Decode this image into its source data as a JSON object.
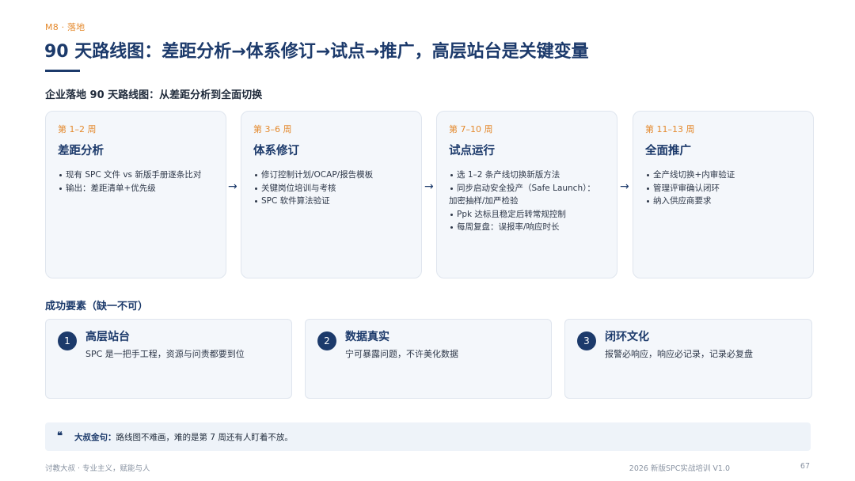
{
  "header": {
    "kicker": "M8 · 落地",
    "title": "90 天路线图：差距分析→体系修订→试点→推广，高层站台是关键变量",
    "subtitle": "企业落地 90 天路线图：从差距分析到全面切换"
  },
  "phases": [
    {
      "week": "第 1–2 周",
      "name": "差距分析",
      "items": [
        "现有 SPC 文件 vs 新版手册逐条比对",
        "输出：差距清单+优先级"
      ]
    },
    {
      "week": "第 3–6 周",
      "name": "体系修订",
      "items": [
        "修订控制计划/OCAP/报告模板",
        "关键岗位培训与考核",
        "SPC 软件算法验证"
      ]
    },
    {
      "week": "第 7–10 周",
      "name": "试点运行",
      "items": [
        "选 1–2 条产线切换新版方法",
        "同步启动安全投产（Safe Launch）：",
        "Ppk 达标且稳定后转常规控制",
        "每周复盘：误报率/响应时长"
      ],
      "item_continuation": "加密抽样/加严检验"
    },
    {
      "week": "第 11–13 周",
      "name": "全面推广",
      "items": [
        "全产线切换+内审验证",
        "管理评审确认闭环",
        "纳入供应商要求"
      ]
    }
  ],
  "arrow_glyph": "→",
  "success": {
    "title": "成功要素（缺一不可）",
    "factors": [
      {
        "num": "1",
        "name": "高层站台",
        "desc": "SPC 是一把手工程，资源与问责都要到位"
      },
      {
        "num": "2",
        "name": "数据真实",
        "desc": "宁可暴露问题，不许美化数据"
      },
      {
        "num": "3",
        "name": "闭环文化",
        "desc": "报警必响应，响应必记录，记录必复盘"
      }
    ]
  },
  "quote": {
    "icon": "quote-icon",
    "label": "大叔金句：",
    "text": "路线图不难画，难的是第 7 周还有人盯着不放。"
  },
  "footer": {
    "left": "讨教大叔 · 专业主义，赋能与人",
    "right": "2026 新版SPC实战培训 V1.0",
    "page": "67"
  },
  "colors": {
    "primary": "#1c3a6b",
    "accent": "#e48a2e",
    "card_bg": "#f4f7fb"
  }
}
